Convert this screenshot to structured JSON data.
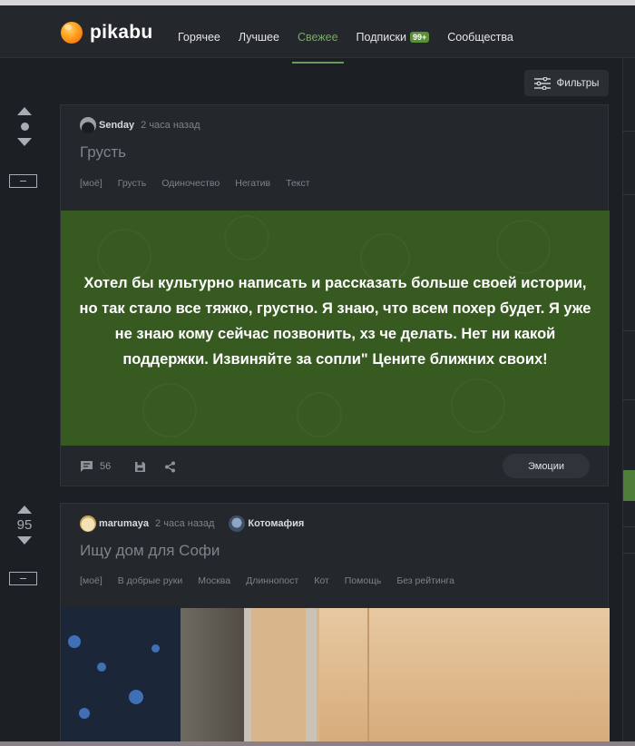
{
  "header": {
    "logo_text": "pikabu",
    "nav": [
      {
        "label": "Горячее",
        "active": false
      },
      {
        "label": "Лучшее",
        "active": false
      },
      {
        "label": "Свежее",
        "active": true
      },
      {
        "label": "Подписки",
        "badge": "99+",
        "active": false
      },
      {
        "label": "Сообщества",
        "active": false
      }
    ]
  },
  "toolbar": {
    "filter_label": "Фильтры"
  },
  "stories": [
    {
      "rating": "",
      "author": "Senday",
      "time": "2 часа назад",
      "title": "Грусть",
      "tags": [
        "[моё]",
        "Грусть",
        "Одиночество",
        "Негатив",
        "Текст"
      ],
      "body_text": "Хотел бы культурно написать и рассказать больше своей истории, но так стало все тяжко, грустно. Я знаю, что всем похер будет. Я уже не знаю кому сейчас позвонить, хз че делать. Нет ни какой поддержки. Извиняйте за сопли\" Цените ближних своих!",
      "comments_count": "56",
      "emotions_label": "Эмоции"
    },
    {
      "rating": "95",
      "author": "marumaya",
      "time": "2 часа назад",
      "community": "Котомафия",
      "title": "Ищу дом для Софи",
      "tags": [
        "[моё]",
        "В добрые руки",
        "Москва",
        "Длиннопост",
        "Кот",
        "Помощь",
        "Без рейтинга"
      ]
    }
  ],
  "colors": {
    "accent_green": "#6b9a5b",
    "post_block_green": "#375a20",
    "badge_green": "#5c8f3a"
  }
}
